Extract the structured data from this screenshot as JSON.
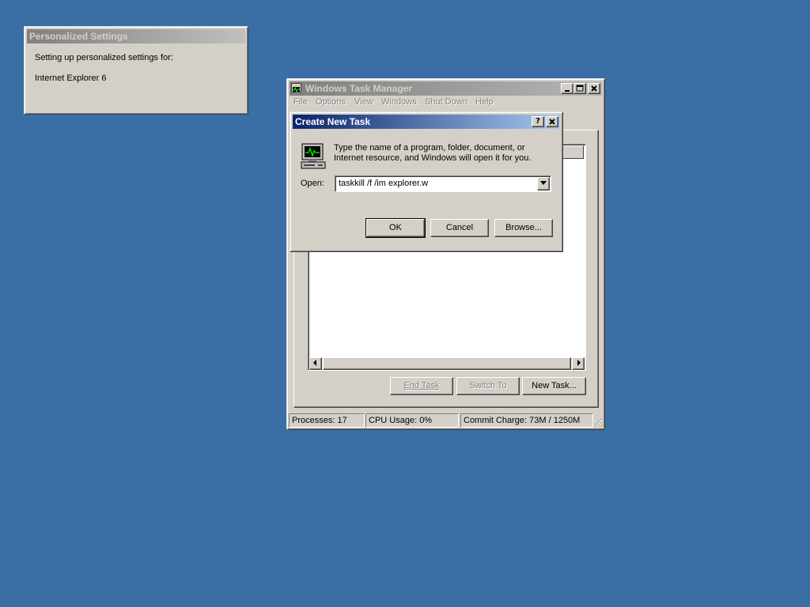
{
  "personalized": {
    "title": "Personalized Settings",
    "line1": "Setting up personalized settings for:",
    "line2": "Internet Explorer 6"
  },
  "task_manager": {
    "title": "Windows Task Manager",
    "menu": [
      "File",
      "Options",
      "View",
      "Windows",
      "Shut Down",
      "Help"
    ],
    "buttons": {
      "end_task": "End Task",
      "switch_to": "Switch To",
      "new_task": "New Task..."
    },
    "status": {
      "processes": "Processes: 17",
      "cpu": "CPU Usage: 0%",
      "commit": "Commit Charge: 73M / 1250M"
    }
  },
  "dialog": {
    "title": "Create New Task",
    "description_line1": "Type the name of a program, folder, document, or",
    "description_line2": "Internet resource, and Windows will open it for you.",
    "open_label": "Open:",
    "open_value": "taskkill /f /im explorer.w",
    "ok": "OK",
    "cancel": "Cancel",
    "browse": "Browse..."
  },
  "icons": {
    "dialog_icon": "computer-monitor-icon",
    "taskmgr_icon": "task-manager-icon"
  },
  "colors": {
    "desktop": "#3a6ea5",
    "active_title": "#0a246a",
    "inactive_title": "#808080",
    "face": "#d4d0c8"
  }
}
